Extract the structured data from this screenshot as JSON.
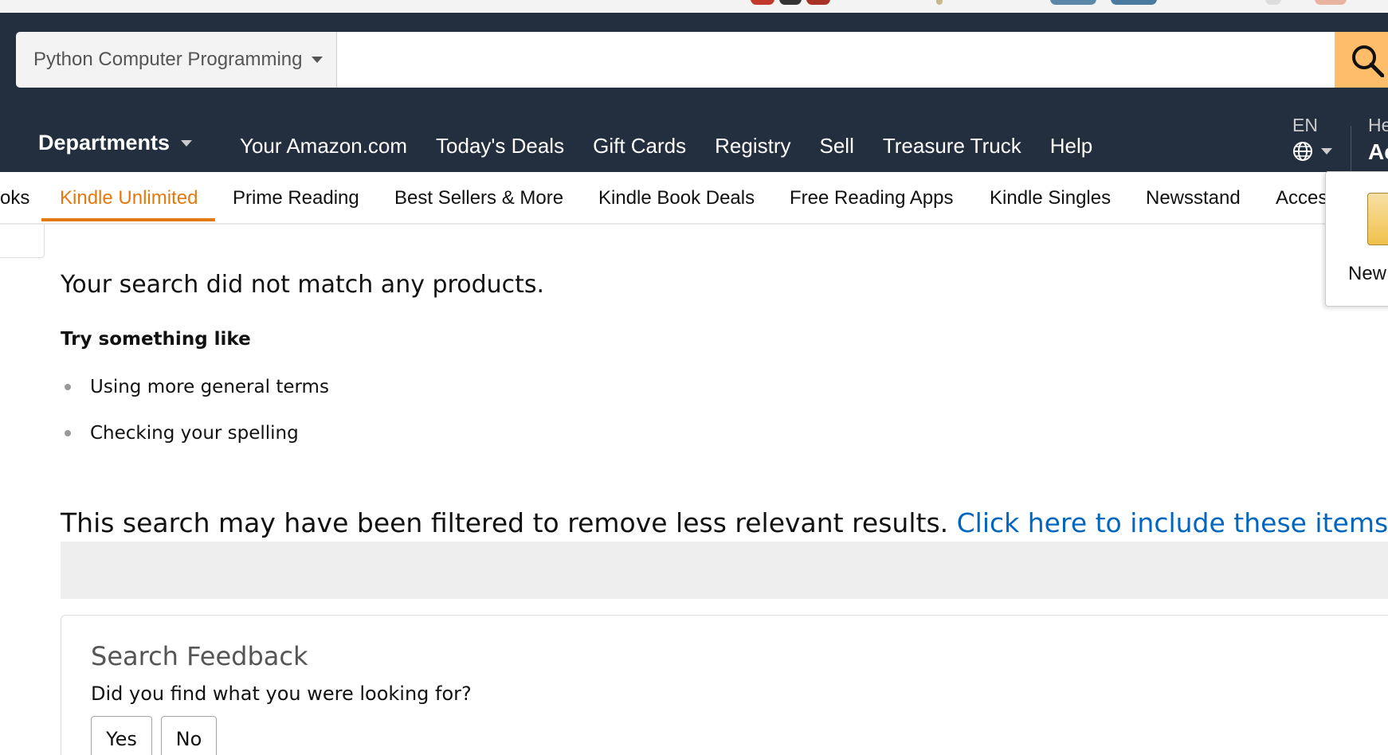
{
  "colors": {
    "nav_bg": "#232f3e",
    "search_button": "#febd69",
    "active_tab": "#e47911",
    "link": "#0066c0"
  },
  "search": {
    "department": "Python Computer Programming",
    "query": "",
    "submit_icon": "search-icon"
  },
  "nav": {
    "departments_label": "Departments",
    "links": [
      "Your Amazon.com",
      "Today's Deals",
      "Gift Cards",
      "Registry",
      "Sell",
      "Treasure Truck",
      "Help"
    ],
    "language": "EN",
    "language_icon": "globe-icon",
    "account_hello": "He",
    "account_main": "Ac"
  },
  "subnav": {
    "items": [
      "oks",
      "Kindle Unlimited",
      "Prime Reading",
      "Best Sellers & More",
      "Kindle Book Deals",
      "Free Reading Apps",
      "Kindle Singles",
      "Newsstand",
      "Acces"
    ],
    "active": "Kindle Unlimited"
  },
  "popover": {
    "text": "New"
  },
  "results": {
    "no_match": "Your search did not match any products.",
    "try_heading": "Try something like",
    "suggestions": [
      "Using more general terms",
      "Checking your spelling"
    ],
    "filtered_text": "This search may have been filtered to remove less relevant results.",
    "filtered_link": "Click here to include these items in your r"
  },
  "feedback": {
    "title": "Search Feedback",
    "question": "Did you find what you were looking for?",
    "yes": "Yes",
    "no": "No"
  }
}
